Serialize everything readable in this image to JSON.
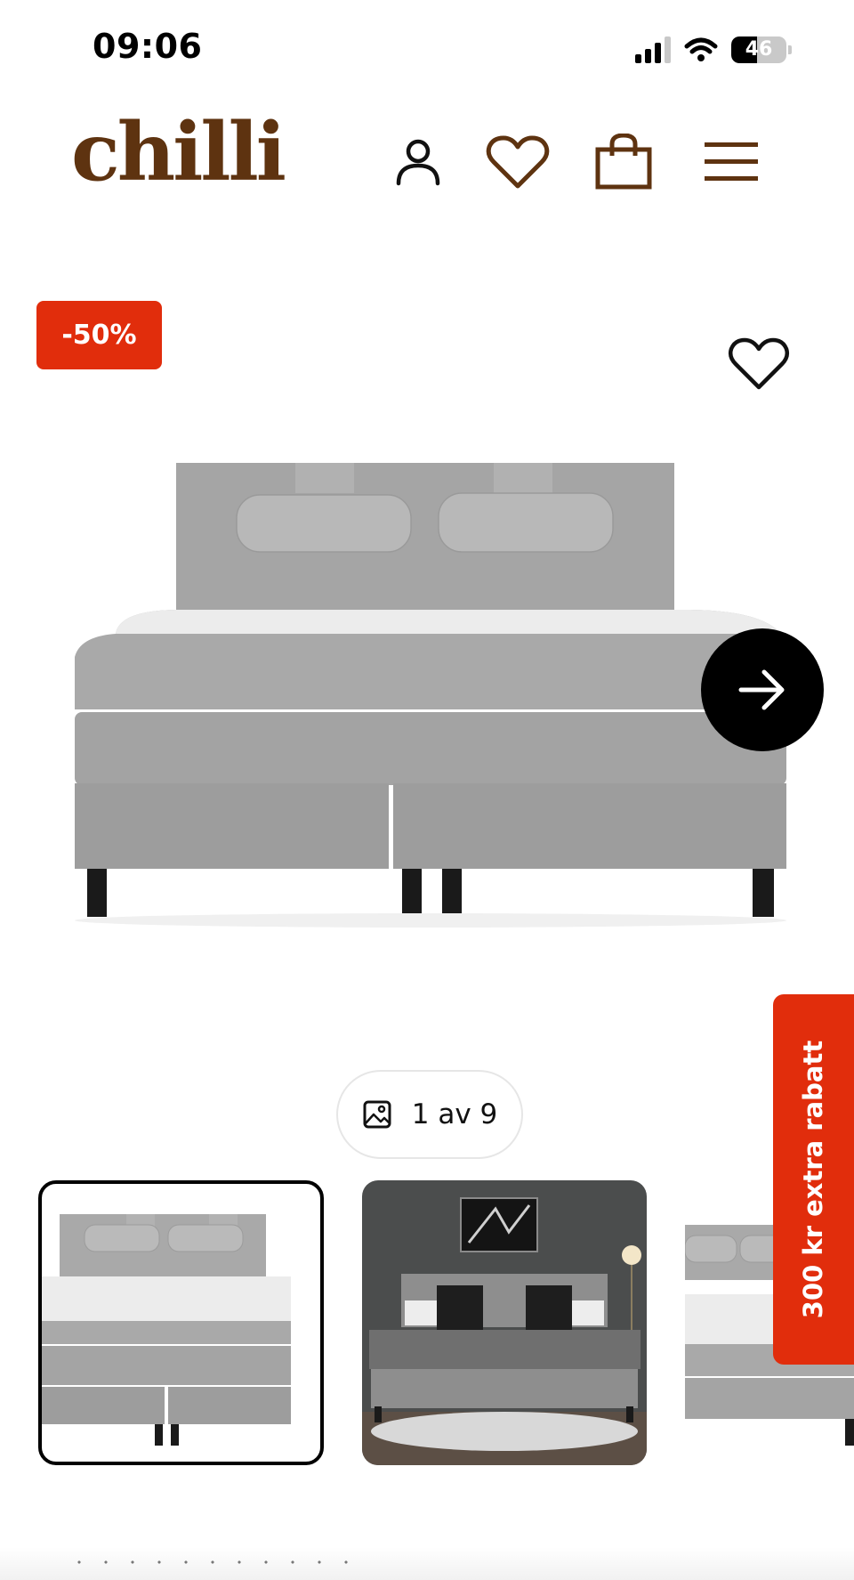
{
  "status_bar": {
    "time": "09:06",
    "battery_level": 46,
    "battery_label": "46",
    "signal_bars_active": 3,
    "signal_bars_total": 4
  },
  "header": {
    "logo": "chilli",
    "logo_color": "#5e3310",
    "icons": [
      "account-icon",
      "wishlist-icon",
      "cart-icon",
      "menu-icon"
    ]
  },
  "product": {
    "discount_badge": "-50%",
    "badge_color": "#e12d0c",
    "image_counter": "1 av 9",
    "image_index": 1,
    "image_total": 9
  },
  "promo_tab": {
    "label": "300 kr extra rabatt",
    "color": "#e12d0c"
  }
}
